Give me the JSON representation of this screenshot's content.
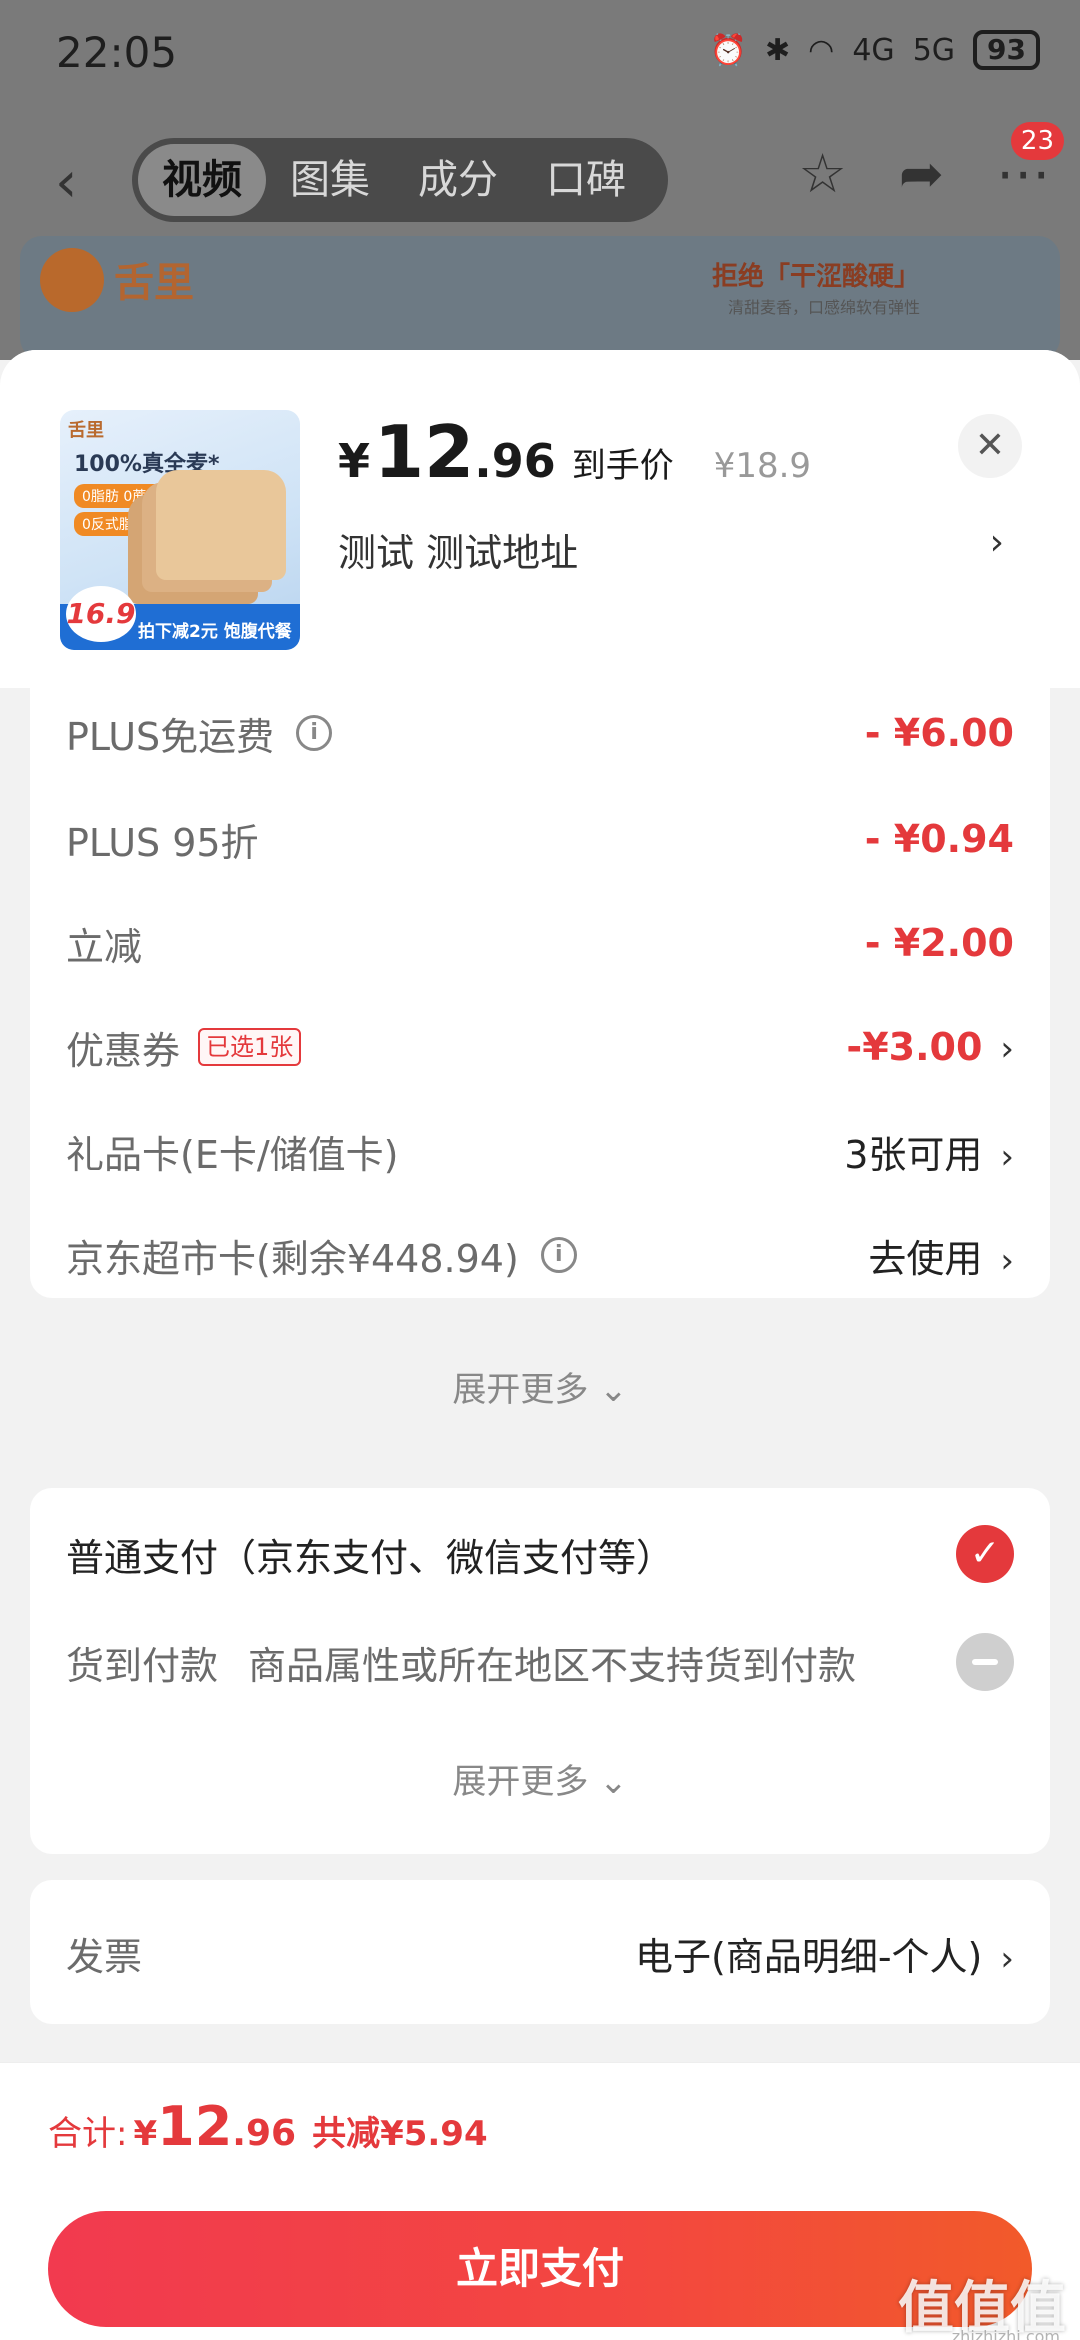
{
  "status_bar": {
    "time": "22:05",
    "battery": "93",
    "network_1": "4G",
    "network_2": "5G"
  },
  "nav": {
    "tabs": [
      "视频",
      "图集",
      "成分",
      "口碑"
    ],
    "active_tab": "视频",
    "badge_count": "23"
  },
  "banner": {
    "brand": "舌里",
    "slogan": "拒绝「干涩酸硬」",
    "sub": "清甜麦香，口感绵软有弹性"
  },
  "product": {
    "thumb_brand": "舌里",
    "thumb_title": "100%真全麦*",
    "thumb_tags": [
      "0脂肪 0蔗糖",
      "0反式脂肪酸"
    ],
    "thumb_price": "16.9",
    "thumb_promo": "拍下减2元 饱腹代餐",
    "price_symbol": "¥",
    "price_int": "12",
    "price_dec": ".96",
    "price_label": "到手价",
    "original_price": "¥18.9",
    "address": "测试  测试地址"
  },
  "discounts": {
    "rows": [
      {
        "label": "PLUS免运费",
        "value": "- ¥6.00"
      },
      {
        "label": "PLUS 95折",
        "value": "- ¥0.94"
      },
      {
        "label": "立减",
        "value": "- ¥2.00"
      },
      {
        "label": "优惠券",
        "tag": "已选1张",
        "value": "-¥3.00"
      },
      {
        "label": "礼品卡(E卡/储值卡)",
        "value": "3张可用"
      },
      {
        "label": "京东超市卡(剩余¥448.94)",
        "value": "去使用"
      }
    ],
    "expand": "展开更多"
  },
  "payment": {
    "normal": "普通支付（京东支付、微信支付等）",
    "cod_label": "货到付款",
    "cod_note": "商品属性或所在地区不支持货到付款",
    "expand": "展开更多"
  },
  "invoice": {
    "label": "发票",
    "value": "电子(商品明细-个人)"
  },
  "footer": {
    "total_label": "合计:",
    "total_symbol": "¥",
    "total_int": "12",
    "total_dec": ".96",
    "saved": "共减¥5.94",
    "pay_button": "立即支付"
  },
  "watermark": {
    "main": "值值值",
    "sub": "zhizhizhi.com"
  },
  "colors": {
    "accent": "#e4393c"
  }
}
